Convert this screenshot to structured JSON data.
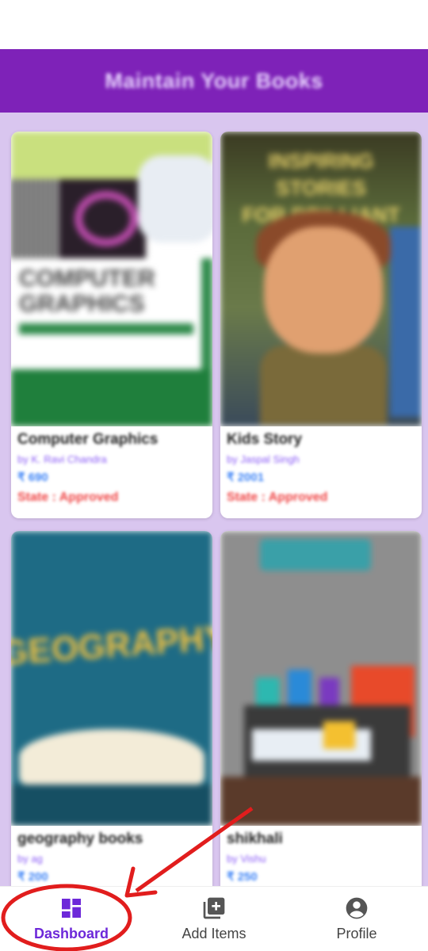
{
  "app_bar": {
    "title": "Maintain Your Books"
  },
  "books": [
    {
      "name": "Computer Graphics",
      "author": "by K. Ravi Chandra",
      "price": "₹ 690",
      "state": "State : Approved"
    },
    {
      "name": "Kids Story",
      "author": "by Jaspal Singh",
      "price": "₹ 2001",
      "state": "State : Approved"
    },
    {
      "name": "geography books",
      "author": "by ag",
      "price": "₹ 200",
      "state": ""
    },
    {
      "name": "shikhali",
      "author": "by Vishu",
      "price": "₹ 250",
      "state": ""
    }
  ],
  "covers": {
    "computer_graphics": {
      "line1": "COMPUTER",
      "line2": "GRAPHICS"
    },
    "kids_story": {
      "line1": "INSPIRING STORIES",
      "line2": "FOR BRILLIANT KIDS"
    },
    "geography": {
      "text": "GEOGRAPHY"
    }
  },
  "bottom_nav": {
    "items": [
      {
        "label": "Dashboard",
        "icon": "dashboard-icon",
        "active": true
      },
      {
        "label": "Add Items",
        "icon": "add-box-icon",
        "active": false
      },
      {
        "label": "Profile",
        "icon": "account-circle-icon",
        "active": false
      }
    ]
  },
  "colors": {
    "app_bar": "#7e22b8",
    "grid_background": "#d9c6ef",
    "accent": "#6d28d9",
    "state_text": "#ef4444",
    "price_text": "#3b82f6",
    "annotation": "#e11d1d"
  }
}
